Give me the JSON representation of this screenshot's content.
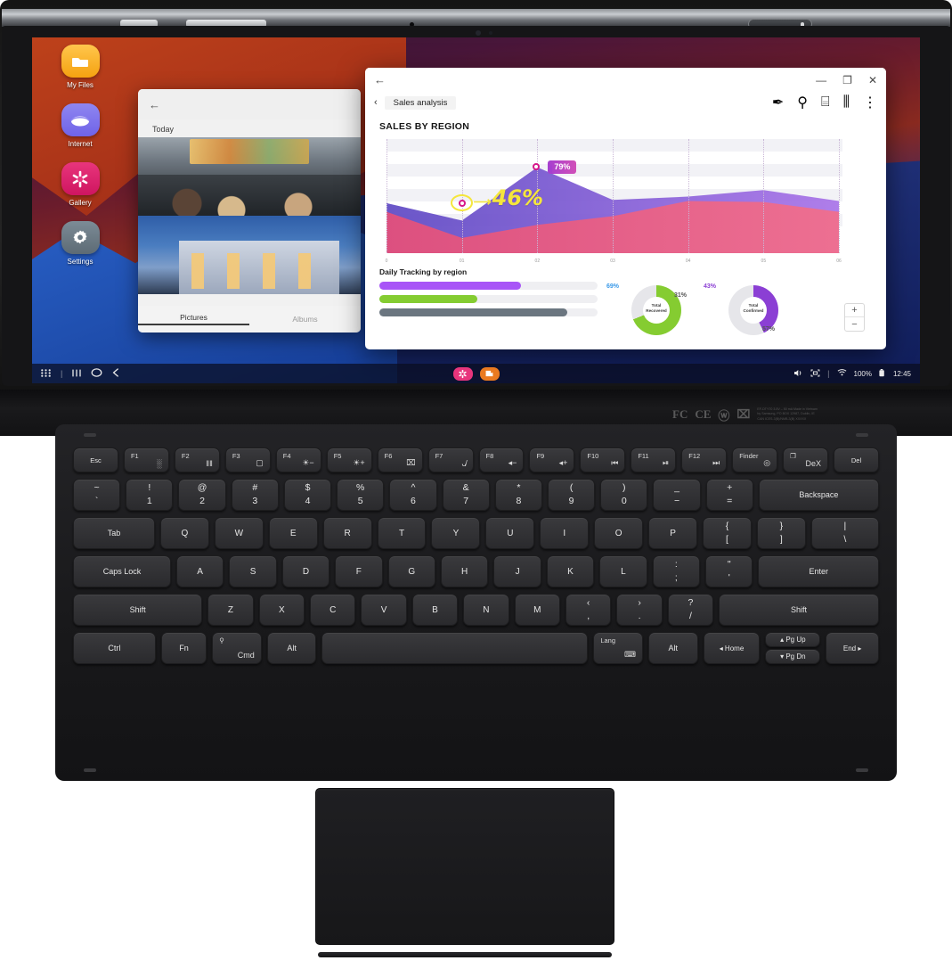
{
  "desktop": {
    "icons": [
      {
        "label": "My Files",
        "icon": "folder-icon"
      },
      {
        "label": "Internet",
        "icon": "browser-icon"
      },
      {
        "label": "Gallery",
        "icon": "flower-icon"
      },
      {
        "label": "Settings",
        "icon": "gear-icon"
      }
    ]
  },
  "gallery_window": {
    "back_icon": "back-arrow-icon",
    "section_label": "Today",
    "tabs": [
      {
        "label": "Pictures",
        "active": true
      },
      {
        "label": "Albums",
        "active": false
      }
    ]
  },
  "sales_window": {
    "back_icon": "back-arrow-icon",
    "window_buttons": {
      "minimize": "—",
      "maximize": "❐",
      "close": "✕"
    },
    "breadcrumb_chevron": "‹",
    "document_name": "Sales analysis",
    "toolbar_icons": [
      {
        "name": "pen-icon",
        "glyph": "✒"
      },
      {
        "name": "search-icon",
        "glyph": "⚲"
      },
      {
        "name": "pdf-export-icon",
        "glyph": "⌸"
      },
      {
        "name": "share-icon",
        "glyph": "⫼"
      },
      {
        "name": "more-options-icon",
        "glyph": "⋮"
      }
    ],
    "heading": "SALES BY REGION",
    "subheading": "Daily Tracking by region",
    "annotation_highlight": "46%",
    "annotation_badge": "79%",
    "zoom_in": "+",
    "zoom_out": "−"
  },
  "chart_data": {
    "type": "area",
    "title": "SALES BY REGION",
    "xlabel": "",
    "ylabel": "",
    "x": [
      "0",
      "01",
      "02",
      "03",
      "04",
      "05",
      "06"
    ],
    "xticklabels": [
      "0",
      "01",
      "02",
      "03",
      "04",
      "05",
      "06"
    ],
    "ylim": [
      0,
      100
    ],
    "grid": "horizontal-bands-and-dotted-verticals",
    "legend": "none",
    "series": [
      {
        "name": "Purple region",
        "color": "#7b4bd0",
        "values": [
          46,
          30,
          79,
          49,
          52,
          58,
          48
        ]
      },
      {
        "name": "Pink region",
        "color": "#e4537f",
        "values": [
          38,
          14,
          26,
          34,
          48,
          47,
          38
        ]
      }
    ],
    "annotations": [
      {
        "label": "79%",
        "x": "02",
        "value": 79,
        "style": "purple-badge",
        "marker": "pink-ring-dot"
      },
      {
        "label": "46%",
        "x": "01",
        "value": 46,
        "style": "yellow-handwritten",
        "marker": "yellow-circle-arrow"
      }
    ],
    "progress_bars": {
      "title": "Daily Tracking by region",
      "items": [
        {
          "name": "bar-purple",
          "color": "#a855f7",
          "value": 65
        },
        {
          "name": "bar-green",
          "color": "#84cc31",
          "value": 45
        },
        {
          "name": "bar-gray",
          "color": "#6b7680",
          "value": 86
        }
      ]
    },
    "donuts": [
      {
        "label": "Total\nConfirmed",
        "label_line1": "Total",
        "label_line2": "Confirmed",
        "color": "#8b3fd4",
        "track_color": "#e6e6ea",
        "value": 43,
        "value_label": "43%",
        "remainder": 57,
        "remainder_label": "57%",
        "value_label_color": "#8b3fd4",
        "remainder_label_color": "#555555"
      },
      {
        "label": "Total\nRecovered",
        "label_line1": "Total",
        "label_line2": "Recovered",
        "color": "#85cc31",
        "track_color": "#e6e6ea",
        "value": 69,
        "value_label": "69%",
        "remainder": 31,
        "remainder_label": "31%",
        "value_label_color": "#3b9ae8",
        "remainder_label_color": "#555555"
      }
    ]
  },
  "taskbar": {
    "left_icons": [
      {
        "name": "apps-grid-icon",
        "glyph": "⠿"
      },
      {
        "name": "divider",
        "glyph": "|"
      },
      {
        "name": "recents-icon",
        "glyph": "‖∣"
      },
      {
        "name": "home-icon",
        "glyph": "◯"
      },
      {
        "name": "back-icon",
        "glyph": "‹"
      }
    ],
    "running_apps": [
      {
        "name": "gallery-app",
        "glyph": "✸",
        "color": "#e8357c"
      },
      {
        "name": "office-app",
        "glyph": "◨",
        "color": "#ea7a20"
      }
    ],
    "tray": {
      "volume_icon": "◂⧨",
      "capture_icon": "❐",
      "divider": "|",
      "wifi_icon": "◴",
      "battery_percent": "100%",
      "battery_icon": "▮",
      "clock": "12:45"
    }
  },
  "regulatory": {
    "marks": [
      "FC",
      "CE",
      "ⓦ",
      "⌧"
    ],
    "text_line1": "EF-DTY70 3.5V – 50 mA Made in Vietnam",
    "text_line2": "by Samsung, PO BOX 12987, Dublin, IE",
    "text_line3": "CAN ICES-3(B)/NMB-3(B) XXXXX"
  },
  "keyboard": {
    "rows": [
      {
        "name": "function-row",
        "keys": [
          {
            "label": "Esc",
            "type": "lbl"
          },
          {
            "fn": "F1",
            "icon": "░",
            "name": "apps-key"
          },
          {
            "fn": "F2",
            "icon": "‖‖",
            "name": "recents-key"
          },
          {
            "fn": "F3",
            "icon": "▢",
            "name": "home-key"
          },
          {
            "fn": "F4",
            "icon": "☀−",
            "name": "brightness-down-key"
          },
          {
            "fn": "F5",
            "icon": "☀+",
            "name": "brightness-up-key"
          },
          {
            "fn": "F6",
            "icon": "⌧",
            "name": "keyboard-backlight-key"
          },
          {
            "fn": "F7",
            "icon": "ᴗ̸",
            "name": "mute-key"
          },
          {
            "fn": "F8",
            "icon": "◂−",
            "name": "volume-down-key"
          },
          {
            "fn": "F9",
            "icon": "◂+",
            "name": "volume-up-key"
          },
          {
            "fn": "F10",
            "icon": "⏮",
            "name": "previous-track-key"
          },
          {
            "fn": "F11",
            "icon": "⏯",
            "name": "play-pause-key"
          },
          {
            "fn": "F12",
            "icon": "⏭",
            "name": "next-track-key"
          },
          {
            "fn": "Finder",
            "icon": "◎",
            "name": "finder-key"
          },
          {
            "fn": "❐",
            "icon": "DeX",
            "name": "dex-key"
          },
          {
            "label": "Del",
            "type": "lbl"
          }
        ]
      },
      {
        "name": "number-row",
        "keys": [
          {
            "up": "~",
            "dn": "`"
          },
          {
            "up": "!",
            "dn": "1"
          },
          {
            "up": "@",
            "dn": "2"
          },
          {
            "up": "#",
            "dn": "3"
          },
          {
            "up": "$",
            "dn": "4"
          },
          {
            "up": "%",
            "dn": "5"
          },
          {
            "up": "^",
            "dn": "6"
          },
          {
            "up": "&",
            "dn": "7"
          },
          {
            "up": "*",
            "dn": "8"
          },
          {
            "up": "(",
            "dn": "9"
          },
          {
            "up": ")",
            "dn": "0"
          },
          {
            "up": "_",
            "dn": "−"
          },
          {
            "up": "+",
            "dn": "="
          },
          {
            "label": "Backspace",
            "type": "lbl",
            "flex": 2.6
          }
        ]
      },
      {
        "name": "top-letter-row",
        "keys": [
          {
            "label": "Tab",
            "type": "lbl",
            "flex": 1.7
          },
          {
            "label": "Q"
          },
          {
            "label": "W"
          },
          {
            "label": "E"
          },
          {
            "label": "R"
          },
          {
            "label": "T"
          },
          {
            "label": "Y"
          },
          {
            "label": "U"
          },
          {
            "label": "I"
          },
          {
            "label": "O"
          },
          {
            "label": "P"
          },
          {
            "up": "{",
            "dn": "["
          },
          {
            "up": "}",
            "dn": "]"
          },
          {
            "up": "|",
            "dn": "\\",
            "flex": 1.4
          }
        ]
      },
      {
        "name": "home-letter-row",
        "keys": [
          {
            "label": "Caps Lock",
            "type": "lbl",
            "flex": 2.1
          },
          {
            "label": "A"
          },
          {
            "label": "S"
          },
          {
            "label": "D"
          },
          {
            "label": "F"
          },
          {
            "label": "G"
          },
          {
            "label": "H"
          },
          {
            "label": "J"
          },
          {
            "label": "K"
          },
          {
            "label": "L"
          },
          {
            "up": ":",
            "dn": ";"
          },
          {
            "up": "\"",
            "dn": "'"
          },
          {
            "label": "Enter",
            "type": "lbl",
            "flex": 2.6
          }
        ]
      },
      {
        "name": "bottom-letter-row",
        "keys": [
          {
            "label": "Shift",
            "type": "lbl",
            "flex": 2.9
          },
          {
            "label": "Z"
          },
          {
            "label": "X"
          },
          {
            "label": "C"
          },
          {
            "label": "V"
          },
          {
            "label": "B"
          },
          {
            "label": "N"
          },
          {
            "label": "M"
          },
          {
            "up": "‹",
            "dn": ","
          },
          {
            "up": "›",
            "dn": "."
          },
          {
            "up": "?",
            "dn": "/"
          },
          {
            "label": "Shift",
            "type": "lbl",
            "flex": 3.6
          }
        ]
      },
      {
        "name": "modifier-row",
        "keys": [
          {
            "label": "Ctrl",
            "type": "lbl",
            "flex": 2.2
          },
          {
            "label": "Fn",
            "type": "lbl",
            "flex": 1.2
          },
          {
            "fn": "⚲",
            "icon": "Cmd",
            "name": "cmd-key",
            "flex": 1.3
          },
          {
            "label": "Alt",
            "type": "lbl",
            "flex": 1.3
          },
          {
            "label": "",
            "type": "space",
            "flex": 7.2
          },
          {
            "fn": "Lang",
            "icon": "⌨",
            "name": "language-key",
            "flex": 1.3
          },
          {
            "label": "Alt",
            "type": "lbl",
            "flex": 1.3
          },
          {
            "label": "◂ Home",
            "type": "small",
            "flex": 1.5
          },
          {
            "label": "",
            "type": "pg",
            "up": "▴ Pg Up",
            "dn": "▾ Pg Dn",
            "flex": 1.5
          },
          {
            "label": "End ▸",
            "type": "small",
            "flex": 1.4
          }
        ]
      }
    ]
  }
}
